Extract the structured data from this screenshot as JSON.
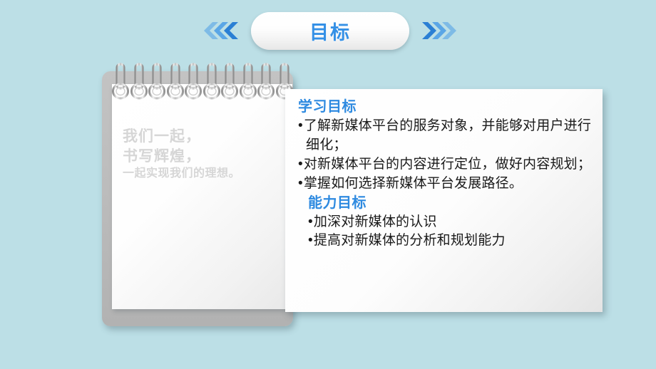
{
  "slide": {
    "background_color": "#bcdfe6",
    "accent_color": "#3490e6",
    "heading_color": "#2e8ae0"
  },
  "header": {
    "title": "目标",
    "left_arrows_icon": "chevrons-left-icon",
    "right_arrows_icon": "chevrons-right-icon"
  },
  "notepad": {
    "watermark": {
      "line1": "我们一起，",
      "line2": "书写辉煌，",
      "line3": "一起实现我们的理想。"
    },
    "ring_count": 10
  },
  "content": {
    "sections": [
      {
        "heading": "学习目标",
        "bullets": [
          "了解新媒体平台的服务对象，并能够对用户进行细化；",
          "对新媒体平台的内容进行定位，做好内容规划；",
          "掌握如何选择新媒体平台发展路径。"
        ]
      },
      {
        "heading": "能力目标",
        "bullets": [
          "加深对新媒体的认识",
          "提高对新媒体的分析和规划能力"
        ]
      }
    ]
  }
}
